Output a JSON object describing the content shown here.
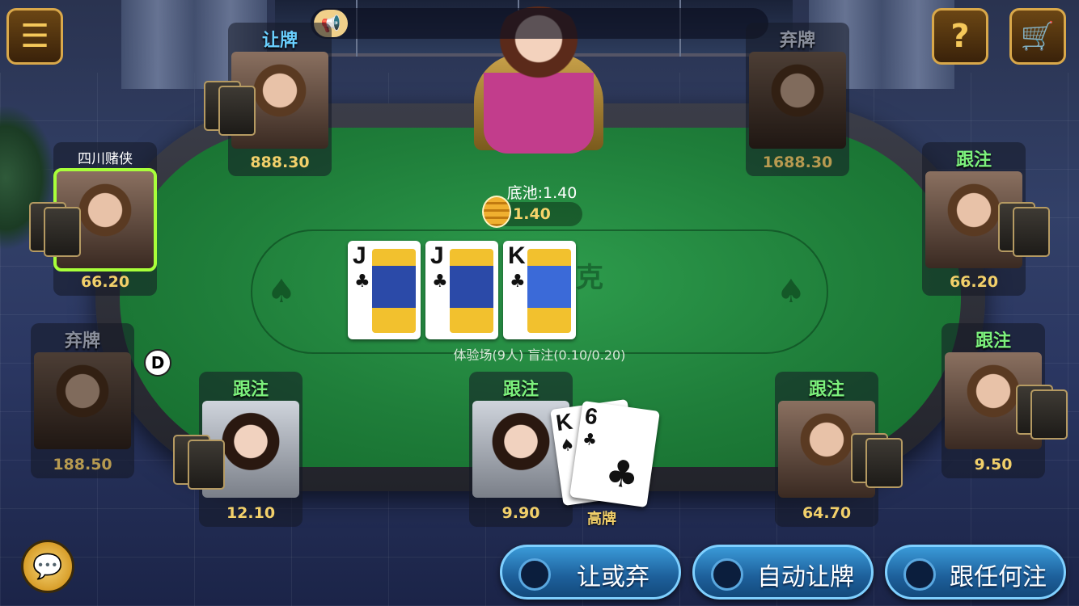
{
  "top_bar": {
    "menu_icon": "menu-icon",
    "help_label": "?",
    "shop_icon": "cart-plus-icon",
    "announcement_icon": "speaker-icon"
  },
  "pot": {
    "label": "底池:1.40",
    "value": "1.40"
  },
  "community_cards": [
    {
      "rank": "J",
      "suit": "♣"
    },
    {
      "rank": "J",
      "suit": "♣"
    },
    {
      "rank": "K",
      "suit": "♣"
    }
  ],
  "table_info": "体验场(9人) 盲注(0.10/0.20)",
  "dealer_button": "D",
  "players": [
    {
      "status": "让牌",
      "chips": "888.30"
    },
    {
      "status": "弃牌",
      "chips": "1688.30"
    },
    {
      "name": "四川赌侠",
      "chips": "66.20"
    },
    {
      "status": "跟注",
      "chips": "66.20"
    },
    {
      "status": "弃牌",
      "chips": "188.50"
    },
    {
      "status": "跟注",
      "chips": "9.50"
    },
    {
      "status": "跟注",
      "chips": "12.10"
    },
    {
      "status": "跟注",
      "chips": "9.90"
    },
    {
      "status": "跟注",
      "chips": "64.70"
    }
  ],
  "my_hand": {
    "cards": [
      {
        "rank": "K",
        "suit": "♠"
      },
      {
        "rank": "6",
        "suit": "♣"
      }
    ],
    "hand_name": "高牌"
  },
  "actions": {
    "check_fold": "让或弃",
    "auto_check": "自动让牌",
    "call_any": "跟任何注"
  },
  "chat_icon": "chat-bubble-icon"
}
